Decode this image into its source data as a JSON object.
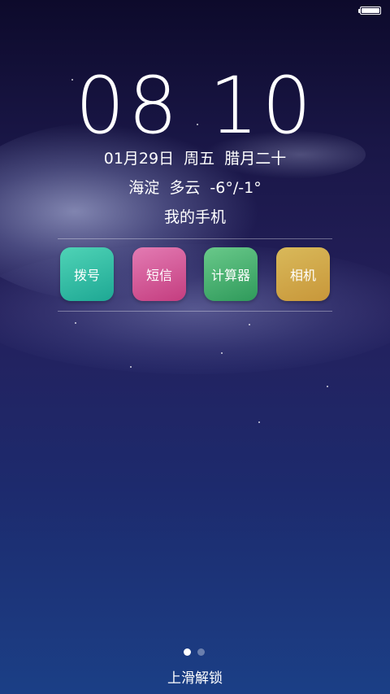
{
  "status_bar": {
    "battery_icon": "battery-icon",
    "battery_level": 1.0
  },
  "clock": {
    "time": "08 10"
  },
  "date": {
    "text": "01月29日  周五  腊月二十"
  },
  "weather": {
    "text": "海淀  多云  -6°/-1°"
  },
  "owner": {
    "name": "我的手机"
  },
  "shortcuts": [
    {
      "label": "拨号",
      "color": "#1ea894"
    },
    {
      "label": "短信",
      "color": "#c43d7f"
    },
    {
      "label": "计算器",
      "color": "#2f9a5b"
    },
    {
      "label": "相机",
      "color": "#c8973a"
    }
  ],
  "pager": {
    "total": 2,
    "active": 1
  },
  "unlock": {
    "hint": "上滑解锁"
  }
}
